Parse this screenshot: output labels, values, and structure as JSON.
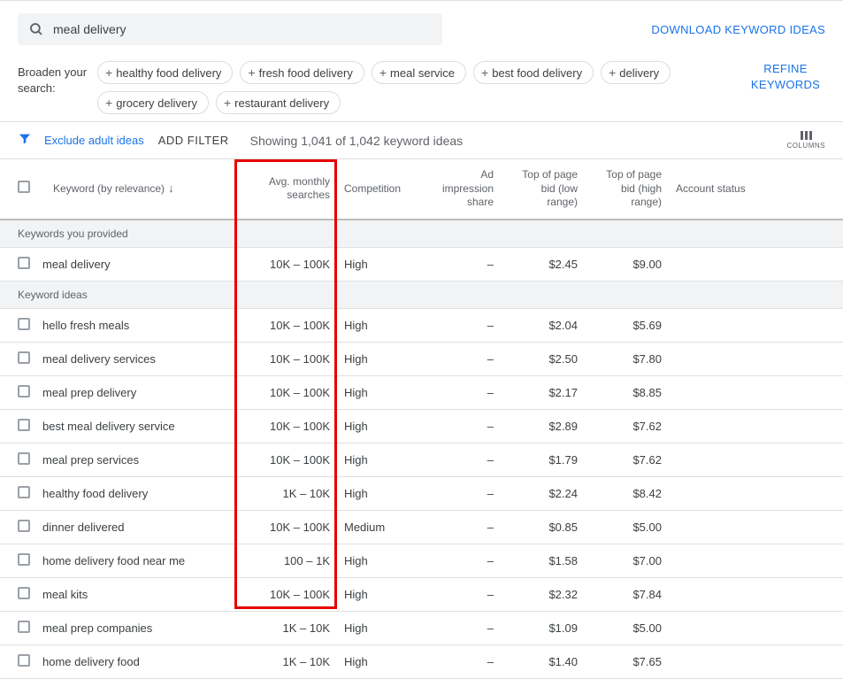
{
  "search": {
    "value": "meal delivery"
  },
  "download_label": "DOWNLOAD KEYWORD IDEAS",
  "broaden": {
    "label": "Broaden your search:",
    "chips": [
      "healthy food delivery",
      "fresh food delivery",
      "meal service",
      "best food delivery",
      "delivery",
      "grocery delivery",
      "restaurant delivery"
    ]
  },
  "refine_label": "REFINE KEYWORDS",
  "filters": {
    "exclude_label": "Exclude adult ideas",
    "add_filter_label": "ADD FILTER",
    "showing_text": "Showing 1,041 of 1,042 keyword ideas",
    "columns_label": "COLUMNS"
  },
  "columns": {
    "keyword": "Keyword (by relevance)",
    "avg": "Avg. monthly searches",
    "competition": "Competition",
    "ad_impression": "Ad impression share",
    "low_bid": "Top of page bid (low range)",
    "high_bid": "Top of page bid (high range)",
    "account_status": "Account status"
  },
  "sections": {
    "provided": "Keywords you provided",
    "ideas": "Keyword ideas"
  },
  "rows_provided": [
    {
      "keyword": "meal delivery",
      "avg": "10K – 100K",
      "competition": "High",
      "ad_impression": "–",
      "low_bid": "$2.45",
      "high_bid": "$9.00"
    }
  ],
  "rows_ideas": [
    {
      "keyword": "hello fresh meals",
      "avg": "10K – 100K",
      "competition": "High",
      "ad_impression": "–",
      "low_bid": "$2.04",
      "high_bid": "$5.69"
    },
    {
      "keyword": "meal delivery services",
      "avg": "10K – 100K",
      "competition": "High",
      "ad_impression": "–",
      "low_bid": "$2.50",
      "high_bid": "$7.80"
    },
    {
      "keyword": "meal prep delivery",
      "avg": "10K – 100K",
      "competition": "High",
      "ad_impression": "–",
      "low_bid": "$2.17",
      "high_bid": "$8.85"
    },
    {
      "keyword": "best meal delivery service",
      "avg": "10K – 100K",
      "competition": "High",
      "ad_impression": "–",
      "low_bid": "$2.89",
      "high_bid": "$7.62"
    },
    {
      "keyword": "meal prep services",
      "avg": "10K – 100K",
      "competition": "High",
      "ad_impression": "–",
      "low_bid": "$1.79",
      "high_bid": "$7.62"
    },
    {
      "keyword": "healthy food delivery",
      "avg": "1K – 10K",
      "competition": "High",
      "ad_impression": "–",
      "low_bid": "$2.24",
      "high_bid": "$8.42"
    },
    {
      "keyword": "dinner delivered",
      "avg": "10K – 100K",
      "competition": "Medium",
      "ad_impression": "–",
      "low_bid": "$0.85",
      "high_bid": "$5.00"
    },
    {
      "keyword": "home delivery food near me",
      "avg": "100 – 1K",
      "competition": "High",
      "ad_impression": "–",
      "low_bid": "$1.58",
      "high_bid": "$7.00"
    },
    {
      "keyword": "meal kits",
      "avg": "10K – 100K",
      "competition": "High",
      "ad_impression": "–",
      "low_bid": "$2.32",
      "high_bid": "$7.84"
    },
    {
      "keyword": "meal prep companies",
      "avg": "1K – 10K",
      "competition": "High",
      "ad_impression": "–",
      "low_bid": "$1.09",
      "high_bid": "$5.00"
    },
    {
      "keyword": "home delivery food",
      "avg": "1K – 10K",
      "competition": "High",
      "ad_impression": "–",
      "low_bid": "$1.40",
      "high_bid": "$7.65"
    }
  ]
}
